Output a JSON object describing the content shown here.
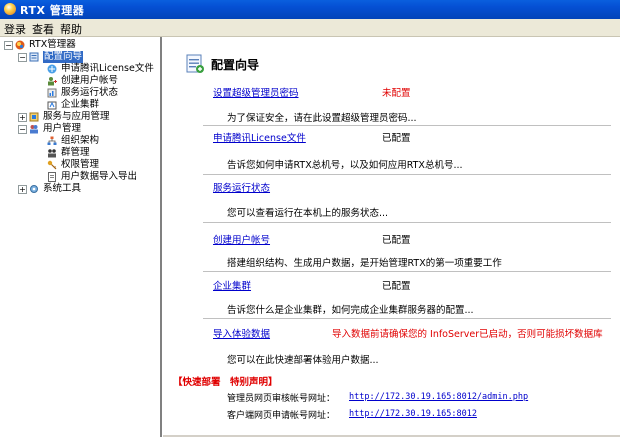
{
  "window": {
    "title": "RTX 管理器"
  },
  "menu": [
    "登录",
    "查看",
    "帮助"
  ],
  "tree": {
    "root": "RTX管理器",
    "config_wizard": "配置向导",
    "config_children": [
      "申请腾讯License文件",
      "创建用户帐号",
      "服务运行状态",
      "企业集群"
    ],
    "service_apps": "服务与应用管理",
    "user_mgmt": "用户管理",
    "user_children": [
      "组织架构",
      "群管理",
      "权限管理",
      "用户数据导入导出"
    ],
    "system_tools": "系统工具"
  },
  "main": {
    "title": "配置向导",
    "items": [
      {
        "link": "设置超级管理员密码",
        "status": "未配置",
        "desc": "为了保证安全，请在此设置超级管理员密码..."
      },
      {
        "link": "申请腾讯License文件",
        "status": "已配置",
        "desc": "告诉您如何申请RTX总机号，以及如何应用RTX总机号..."
      },
      {
        "link": "服务运行状态",
        "status": "",
        "desc": "您可以查看运行在本机上的服务状态..."
      },
      {
        "link": "创建用户帐号",
        "status": "已配置",
        "desc": "搭建组织结构、生成用户数据，是开始管理RTX的第一项重要工作"
      },
      {
        "link": "企业集群",
        "status": "已配置",
        "desc": "告诉您什么是企业集群，如何完成企业集群服务器的配置..."
      },
      {
        "link": "导入体验数据",
        "status": "导入数据前请确保您的 InfoServer已启动，否则可能损坏数据库",
        "desc": "您可以在此快速部署体验用户数据..."
      }
    ],
    "notice": {
      "title": "【快速部署　特别声明】",
      "admin_label": "管理员网页审核帐号网址：",
      "admin_url": "http://172.30.19.165:8012/admin.php",
      "client_label": "客户端网页申请帐号网址：",
      "client_url": "http://172.30.19.165:8012"
    }
  },
  "colors": {
    "titlebar": "#0550d4",
    "link": "#0000cc",
    "alert": "#e00000",
    "selection": "#316ac5"
  }
}
